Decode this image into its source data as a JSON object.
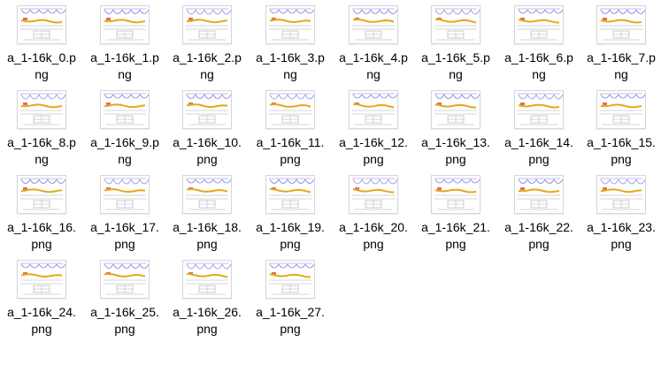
{
  "window": {
    "view": "Large icons",
    "item_count": 28
  },
  "files": [
    {
      "line1": "a_1-16k_0.p",
      "line2": "ng"
    },
    {
      "line1": "a_1-16k_1.p",
      "line2": "ng"
    },
    {
      "line1": "a_1-16k_2.p",
      "line2": "ng"
    },
    {
      "line1": "a_1-16k_3.p",
      "line2": "ng"
    },
    {
      "line1": "a_1-16k_4.p",
      "line2": "ng"
    },
    {
      "line1": "a_1-16k_5.p",
      "line2": "ng"
    },
    {
      "line1": "a_1-16k_6.p",
      "line2": "ng"
    },
    {
      "line1": "a_1-16k_7.p",
      "line2": "ng"
    },
    {
      "line1": "a_1-16k_8.p",
      "line2": "ng"
    },
    {
      "line1": "a_1-16k_9.p",
      "line2": "ng"
    },
    {
      "line1": "a_1-16k_10.",
      "line2": "png"
    },
    {
      "line1": "a_1-16k_11.",
      "line2": "png"
    },
    {
      "line1": "a_1-16k_12.",
      "line2": "png"
    },
    {
      "line1": "a_1-16k_13.",
      "line2": "png"
    },
    {
      "line1": "a_1-16k_14.",
      "line2": "png"
    },
    {
      "line1": "a_1-16k_15.",
      "line2": "png"
    },
    {
      "line1": "a_1-16k_16.",
      "line2": "png"
    },
    {
      "line1": "a_1-16k_17.",
      "line2": "png"
    },
    {
      "line1": "a_1-16k_18.",
      "line2": "png"
    },
    {
      "line1": "a_1-16k_19.",
      "line2": "png"
    },
    {
      "line1": "a_1-16k_20.",
      "line2": "png"
    },
    {
      "line1": "a_1-16k_21.",
      "line2": "png"
    },
    {
      "line1": "a_1-16k_22.",
      "line2": "png"
    },
    {
      "line1": "a_1-16k_23.",
      "line2": "png"
    },
    {
      "line1": "a_1-16k_24.",
      "line2": "png"
    },
    {
      "line1": "a_1-16k_25.",
      "line2": "png"
    },
    {
      "line1": "a_1-16k_26.",
      "line2": "png"
    },
    {
      "line1": "a_1-16k_27.",
      "line2": "png"
    }
  ],
  "colors": {
    "thumb_wave": "#8080e0",
    "thumb_line": "#e6a817",
    "thumb_accent": "#d94a2a",
    "thumb_table": "#999999"
  }
}
